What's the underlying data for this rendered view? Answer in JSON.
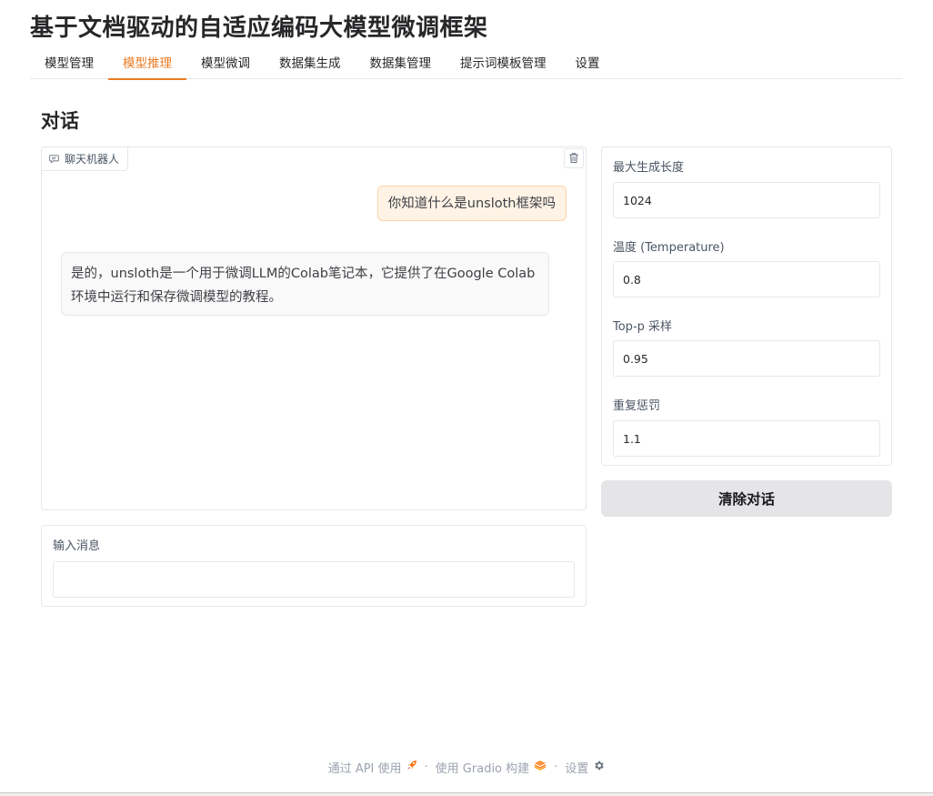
{
  "app": {
    "title": "基于文档驱动的自适应编码大模型微调框架"
  },
  "tabs": [
    {
      "label": "模型管理",
      "active": false
    },
    {
      "label": "模型推理",
      "active": true
    },
    {
      "label": "模型微调",
      "active": false
    },
    {
      "label": "数据集生成",
      "active": false
    },
    {
      "label": "数据集管理",
      "active": false
    },
    {
      "label": "提示词模板管理",
      "active": false
    },
    {
      "label": "设置",
      "active": false
    }
  ],
  "section": {
    "title": "对话"
  },
  "chatbot": {
    "label": "聊天机器人",
    "label_icon": "chat-icon",
    "clear_icon": "trash-icon",
    "messages": [
      {
        "role": "user",
        "text": "你知道什么是unsloth框架吗"
      },
      {
        "role": "assistant",
        "text": "是的，unsloth是一个用于微调LLM的Colab笔记本，它提供了在Google Colab环境中运行和保存微调模型的教程。"
      }
    ]
  },
  "input": {
    "label": "输入消息",
    "value": "",
    "placeholder": ""
  },
  "params": {
    "max_length": {
      "label": "最大生成长度",
      "value": "1024"
    },
    "temperature": {
      "label": "温度 (Temperature)",
      "value": "0.8"
    },
    "top_p": {
      "label": "Top-p 采样",
      "value": "0.95"
    },
    "repetition_penalty": {
      "label": "重复惩罚",
      "value": "1.1"
    }
  },
  "clear_button": {
    "label": "清除对话"
  },
  "footer": {
    "api": "通过 API 使用",
    "gradio": "使用 Gradio 构建",
    "settings": "设置",
    "separator": "·"
  },
  "colors": {
    "accent": "#ea7a22",
    "user_bubble": "#fff3e6",
    "user_bubble_border": "#fbd3a8",
    "button_bg": "#e5e5e7"
  }
}
